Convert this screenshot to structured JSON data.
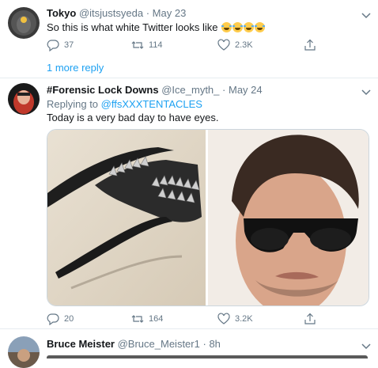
{
  "tweets": [
    {
      "name": "Tokyo",
      "handle": "@itsjustsyeda",
      "sep": "·",
      "date": "May 23",
      "text": "So this is what white Twitter looks like",
      "emoji": [
        "😂",
        "😂",
        "😂",
        "😂"
      ],
      "replies": "37",
      "retweets": "114",
      "likes": "2.3K",
      "more_replies": "1 more reply"
    },
    {
      "name": "#Forensic Lock Downs",
      "handle": "@Ice_myth_",
      "sep": "·",
      "date": "May 24",
      "replying_prefix": "Replying to",
      "replying_to": "@ffsXXXTENTACLES",
      "text": "Today is a very bad day to have eyes.",
      "replies": "20",
      "retweets": "164",
      "likes": "3.2K"
    },
    {
      "name": "Bruce Meister",
      "handle": "@Bruce_Meister1",
      "sep": "·",
      "date": "8h"
    }
  ],
  "icons": {
    "reply": "reply-icon",
    "retweet": "retweet-icon",
    "like": "heart-icon",
    "share": "share-icon",
    "caret": "chevron-down-icon"
  },
  "colors": {
    "link": "#1da1f2",
    "muted": "#657786",
    "divider": "#e6ecf0"
  }
}
